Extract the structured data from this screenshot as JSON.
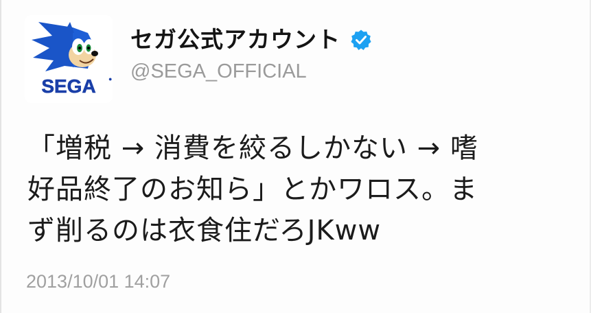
{
  "account": {
    "display_name": "セガ公式アカウント",
    "handle": "@SEGA_OFFICIAL",
    "avatar_logo_text": "SEGA",
    "verified_badge_icon": "verified-badge-icon",
    "verified_color": "#1da1f2"
  },
  "tweet": {
    "lines": [
      "「増税 → 消費を絞るしかない → 嗜",
      "好品終了のお知ら」とかワロス。ま",
      "ず削るのは衣食住だろJKww"
    ],
    "timestamp": "2013/10/01 14:07"
  },
  "colors": {
    "name_text": "#141414",
    "handle_text": "#9a9a9a",
    "body_text": "#1b1b1b",
    "timestamp_text": "#a0a0a0",
    "sega_blue": "#1a3fa8"
  }
}
